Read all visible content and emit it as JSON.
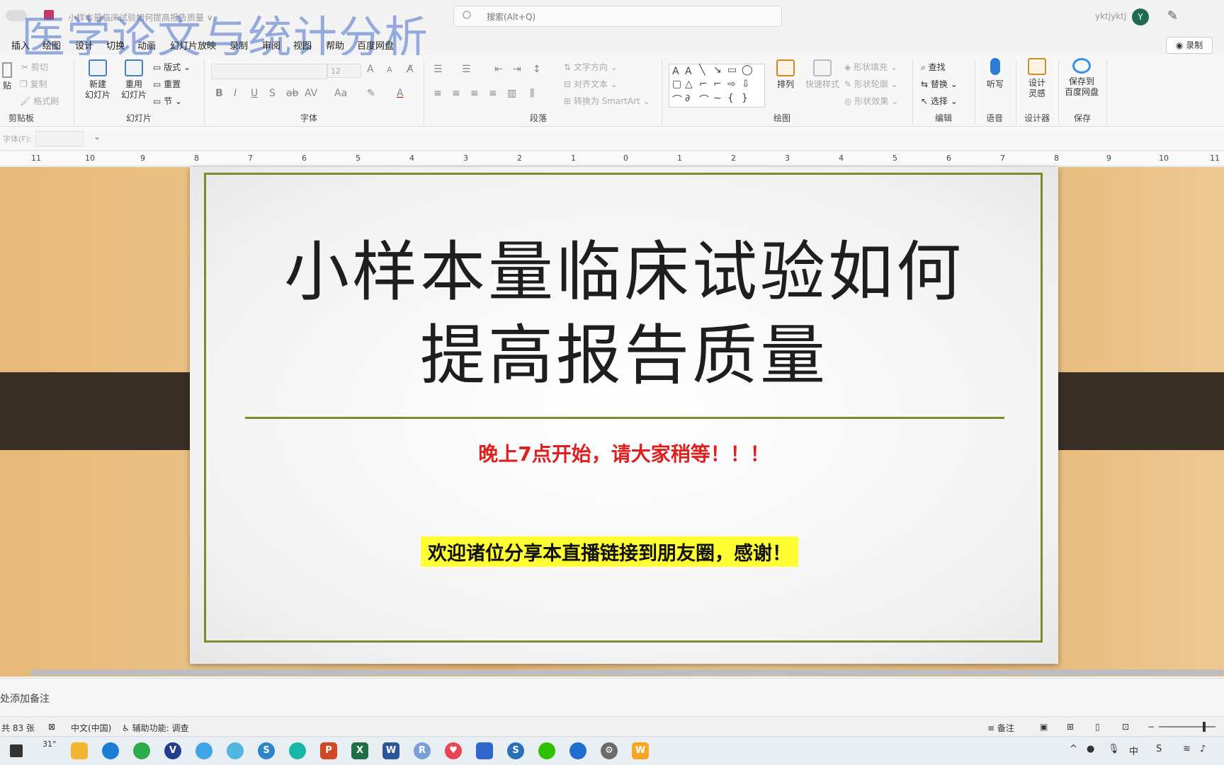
{
  "window": {
    "watermark": "医学论文与统计分析",
    "doc_title": "小样本量临床试验如何提高报告质量 ∨",
    "search_placeholder": "搜索(Alt+Q)",
    "username": "yktjyktj",
    "avatar_letter": "Y",
    "record_label": "◉ 录制"
  },
  "menu_tabs": [
    "插入",
    "绘图",
    "设计",
    "切换",
    "动画",
    "幻灯片放映",
    "录制",
    "审阅",
    "视图",
    "帮助",
    "百度网盘"
  ],
  "ribbon": {
    "clipboard": {
      "paste": "贴",
      "cut": "剪切",
      "copy": "复制",
      "format_painter": "格式刷",
      "label": "剪贴板"
    },
    "slides": {
      "new_slide": "新建\n幻灯片",
      "reuse_slide": "重用\n幻灯片",
      "layout": "版式",
      "reset": "重置",
      "section": "节",
      "label": "幻灯片"
    },
    "font": {
      "size": "12",
      "label": "字体"
    },
    "paragraph": {
      "text_direction": "文字方向",
      "align_text": "对齐文本",
      "smartart": "转换为 SmartArt",
      "label": "段落"
    },
    "drawing": {
      "arrange": "排列",
      "quick_styles": "快速样式",
      "shape_fill": "形状填充",
      "shape_outline": "形状轮廓",
      "shape_effects": "形状效果",
      "label": "绘图"
    },
    "editing": {
      "find": "查找",
      "replace": "替换",
      "select": "选择",
      "label": "编辑"
    },
    "voice": {
      "dictate": "听写",
      "label": "语音"
    },
    "designer": {
      "design_ideas": "设计\n灵感",
      "label": "设计器"
    },
    "save": {
      "save_baidu": "保存到\n百度网盘",
      "label": "保存"
    }
  },
  "fontbar": {
    "label": "字体(F):"
  },
  "ruler_ticks": [
    "11",
    "10",
    "9",
    "8",
    "7",
    "6",
    "5",
    "4",
    "3",
    "2",
    "1",
    "0",
    "1",
    "2",
    "3",
    "4",
    "5",
    "6",
    "7",
    "8",
    "9",
    "10",
    "11"
  ],
  "slide": {
    "title_line1": "小样本量临床试验如何",
    "title_line2": "提高报告质量",
    "notice": "晚上7点开始，请大家稍等！！！",
    "share": "欢迎诸位分享本直播链接到朋友圈，感谢！"
  },
  "notes": {
    "placeholder": "处添加备注"
  },
  "statusbar": {
    "slide_count": "共 83 张",
    "language": "中文(中国)",
    "accessibility": "辅助功能: 调查",
    "notes_button": "备注"
  },
  "taskbar": {
    "weather": "31°",
    "apps": [
      "edge",
      "wechat",
      "v-app",
      "browser",
      "baidu",
      "sogou",
      "app",
      "powerpoint",
      "excel",
      "word",
      "r",
      "app-red",
      "app-blue",
      "app-blue2",
      "wechat2",
      "app-blue3",
      "settings",
      "app-orange"
    ]
  },
  "colors": {
    "accent": "#7d8a2e",
    "notice": "#e01f1f",
    "highlight": "#ffff33",
    "watermark": "#466ec8"
  }
}
